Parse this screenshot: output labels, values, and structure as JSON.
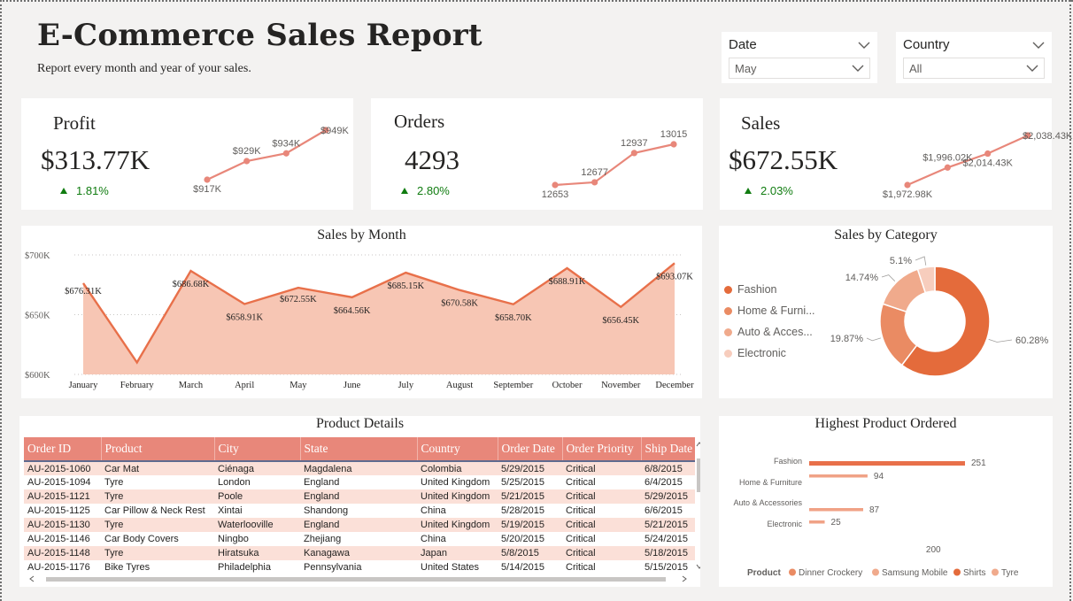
{
  "header": {
    "title": "E-Commerce Sales Report",
    "subtitle": "Report every month and year of your sales."
  },
  "slicers": {
    "date": {
      "label": "Date",
      "value": "May"
    },
    "country": {
      "label": "Country",
      "value": "All"
    }
  },
  "kpis": {
    "profit": {
      "title": "Profit",
      "value": "$313.77K",
      "delta": "1.81%",
      "points": [
        917,
        929,
        934,
        949
      ],
      "labels": [
        "$917K",
        "$929K",
        "$934K",
        "$949K"
      ]
    },
    "orders": {
      "title": "Orders",
      "value": "4293",
      "delta": "2.80%",
      "points": [
        12653,
        12677,
        12937,
        13015
      ],
      "labels": [
        "12653",
        "12677",
        "12937",
        "13015"
      ]
    },
    "sales": {
      "title": "Sales",
      "value": "$672.55K",
      "delta": "2.03%",
      "points": [
        1972.98,
        1996.02,
        2014.43,
        2038.43
      ],
      "labels": [
        "$1,972.98K",
        "$1,996.02K",
        "$2,014.43K",
        "$2,038.43K"
      ]
    }
  },
  "colors": {
    "accent": "#e8704a",
    "area": "#f7c6b4",
    "line": "#e8704a",
    "spark": "#e8877a",
    "positive": "#107c10",
    "header_row": "#e8877a",
    "alt_row": "#fbe0d8",
    "cat_fashion": "#e46b3b",
    "cat_home": "#ea8b63",
    "cat_auto": "#f0aa8c",
    "cat_electronic": "#f7cdbd"
  },
  "chart_data": [
    {
      "type": "area",
      "title": "Sales by Month",
      "categories": [
        "January",
        "February",
        "March",
        "April",
        "May",
        "June",
        "July",
        "August",
        "September",
        "October",
        "November",
        "December"
      ],
      "values": [
        676.31,
        610,
        686.68,
        658.91,
        672.55,
        664.56,
        685.15,
        670.58,
        658.7,
        688.91,
        656.45,
        693.07
      ],
      "labels": [
        "$676.31K",
        "",
        "$686.68K",
        "$658.91K",
        "$672.55K",
        "$664.56K",
        "$685.15K",
        "$670.58K",
        "$658.70K",
        "$688.91K",
        "$656.45K",
        "$693.07K"
      ],
      "ytick_labels": [
        "$700K",
        "$650K",
        "$600K"
      ],
      "ylim": [
        600,
        700
      ],
      "yticks": [
        700,
        650,
        600
      ],
      "grid": true
    },
    {
      "type": "pie",
      "title": "Sales by Category",
      "categories": [
        "Fashion",
        "Home & Furni...",
        "Auto & Acces...",
        "Electronic"
      ],
      "values": [
        60.28,
        19.87,
        14.74,
        5.1
      ],
      "labels": [
        "60.28%",
        "19.87%",
        "14.74%",
        "5.1%"
      ],
      "legend": "left"
    },
    {
      "type": "bar",
      "title": "Highest Product Ordered",
      "categories": [
        "Fashion",
        "Home & Furniture",
        "Auto & Accessories",
        "Electronic"
      ],
      "values": [
        251,
        94,
        87,
        25
      ],
      "xticks": [
        200
      ],
      "legend_title": "Product",
      "legend_items": [
        "Dinner Crockery",
        "Samsung Mobile",
        "Shirts",
        "Tyre"
      ]
    }
  ],
  "product_details": {
    "title": "Product Details",
    "columns": [
      "Order ID",
      "Product",
      "City",
      "State",
      "Country",
      "Order Date",
      "Order Priority",
      "Ship Date"
    ],
    "rows": [
      [
        "AU-2015-1060",
        "Car Mat",
        "Ciénaga",
        "Magdalena",
        "Colombia",
        "5/29/2015",
        "Critical",
        "6/8/2015"
      ],
      [
        "AU-2015-1094",
        "Tyre",
        "London",
        "England",
        "United Kingdom",
        "5/25/2015",
        "Critical",
        "6/4/2015"
      ],
      [
        "AU-2015-1121",
        "Tyre",
        "Poole",
        "England",
        "United Kingdom",
        "5/21/2015",
        "Critical",
        "5/29/2015"
      ],
      [
        "AU-2015-1125",
        "Car Pillow & Neck Rest",
        "Xintai",
        "Shandong",
        "China",
        "5/28/2015",
        "Critical",
        "6/6/2015"
      ],
      [
        "AU-2015-1130",
        "Tyre",
        "Waterlooville",
        "England",
        "United Kingdom",
        "5/19/2015",
        "Critical",
        "5/21/2015"
      ],
      [
        "AU-2015-1146",
        "Car Body Covers",
        "Ningbo",
        "Zhejiang",
        "China",
        "5/20/2015",
        "Critical",
        "5/24/2015"
      ],
      [
        "AU-2015-1148",
        "Tyre",
        "Hiratsuka",
        "Kanagawa",
        "Japan",
        "5/8/2015",
        "Critical",
        "5/18/2015"
      ],
      [
        "AU-2015-1176",
        "Bike Tyres",
        "Philadelphia",
        "Pennsylvania",
        "United States",
        "5/14/2015",
        "Critical",
        "5/15/2015"
      ]
    ]
  }
}
